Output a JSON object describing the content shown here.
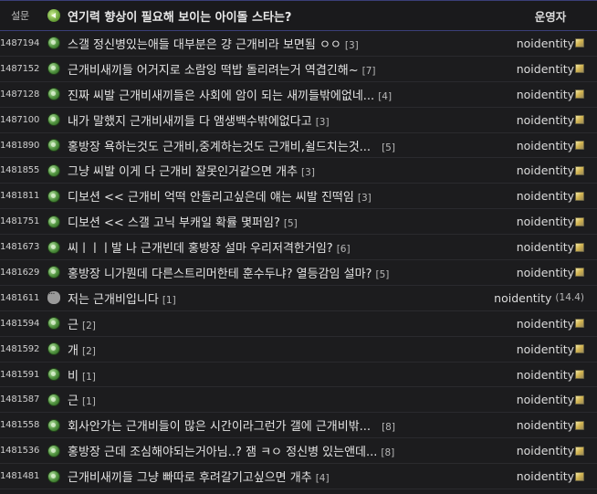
{
  "header": {
    "num_label": "설문",
    "title": "연기력 향상이 필요해 보이는 아이돌 스타는?",
    "author_label": "운영자"
  },
  "rows": [
    {
      "num": "1487194",
      "icon": "green",
      "title": "스갤 정신병있는애들 대부분은 걍 근개비라 보면됨 ㅇㅇ",
      "comments": "[3]",
      "author": "noidentity",
      "badge": true,
      "gap": false
    },
    {
      "num": "1487152",
      "icon": "green",
      "title": "근개비새끼들 어거지로 소람잉 떡밥 돌리려는거 역겹긴해~",
      "comments": "[7]",
      "author": "noidentity",
      "badge": true,
      "gap": false
    },
    {
      "num": "1487128",
      "icon": "green",
      "title": "진짜 씨발 근개비새끼들은 사회에 암이 되는 새끼들밖에없네...",
      "comments": "[4]",
      "author": "noidentity",
      "badge": true,
      "gap": false
    },
    {
      "num": "1487100",
      "icon": "green",
      "title": "내가 말했지 근개비새끼들 다 앰생백수밖에없다고",
      "comments": "[3]",
      "author": "noidentity",
      "badge": true,
      "gap": false
    },
    {
      "num": "1481890",
      "icon": "green",
      "title": "홍방장 욕하는것도 근개비,중계하는것도 근개비,쉴드치는것...",
      "comments": "[5]",
      "author": "noidentity",
      "badge": true,
      "gap": true
    },
    {
      "num": "1481855",
      "icon": "green",
      "title": "그냥 씨발 이게 다 근개비 잘못인거같으면 개추",
      "comments": "[3]",
      "author": "noidentity",
      "badge": true,
      "gap": false
    },
    {
      "num": "1481811",
      "icon": "green",
      "title": "디보션 << 근개비 억떡 안돌리고싶은데 얘는 씨발 진떡임",
      "comments": "[3]",
      "author": "noidentity",
      "badge": true,
      "gap": false
    },
    {
      "num": "1481751",
      "icon": "green",
      "title": "디보션 << 스갤 고닉 부캐일 확률 몇퍼임?",
      "comments": "[5]",
      "author": "noidentity",
      "badge": true,
      "gap": false
    },
    {
      "num": "1481673",
      "icon": "green",
      "title": "씨ㅣㅣㅣ발 나 근개빈데 홍방장 설마 우리저격한거임?",
      "comments": "[6]",
      "author": "noidentity",
      "badge": true,
      "gap": false
    },
    {
      "num": "1481629",
      "icon": "green",
      "title": "홍방장 니가뭔데 다른스트리머한테 훈수두냐? 열등감임 설마?",
      "comments": "[5]",
      "author": "noidentity",
      "badge": true,
      "gap": false
    },
    {
      "num": "1481611",
      "icon": "bubble",
      "title": "저는 근개비입니다",
      "comments": "[1]",
      "author": "noidentity",
      "badge": false,
      "author_sub": "(14.4)",
      "gap": false
    },
    {
      "num": "1481594",
      "icon": "green",
      "title": "근",
      "comments": "[2]",
      "author": "noidentity",
      "badge": true,
      "gap": false
    },
    {
      "num": "1481592",
      "icon": "green",
      "title": "개",
      "comments": "[2]",
      "author": "noidentity",
      "badge": true,
      "gap": false
    },
    {
      "num": "1481591",
      "icon": "green",
      "title": "비",
      "comments": "[1]",
      "author": "noidentity",
      "badge": true,
      "gap": false
    },
    {
      "num": "1481587",
      "icon": "green",
      "title": "근",
      "comments": "[1]",
      "author": "noidentity",
      "badge": true,
      "gap": false
    },
    {
      "num": "1481558",
      "icon": "green",
      "title": "회사안가는 근개비들이 많은 시간이라그런가 갤에 근개비밖...",
      "comments": "[8]",
      "author": "noidentity",
      "badge": true,
      "gap": true
    },
    {
      "num": "1481536",
      "icon": "green",
      "title": "홍방장 근데 조심해야되는거아님..? 잼 ㅋㅇ 정신병 있는앤데...",
      "comments": "[8]",
      "author": "noidentity",
      "badge": true,
      "gap": false
    },
    {
      "num": "1481481",
      "icon": "green",
      "title": "근개비새끼들 그냥 빠따로 후려갈기고싶으면 개추",
      "comments": "[4]",
      "author": "noidentity",
      "badge": true,
      "gap": false
    }
  ]
}
